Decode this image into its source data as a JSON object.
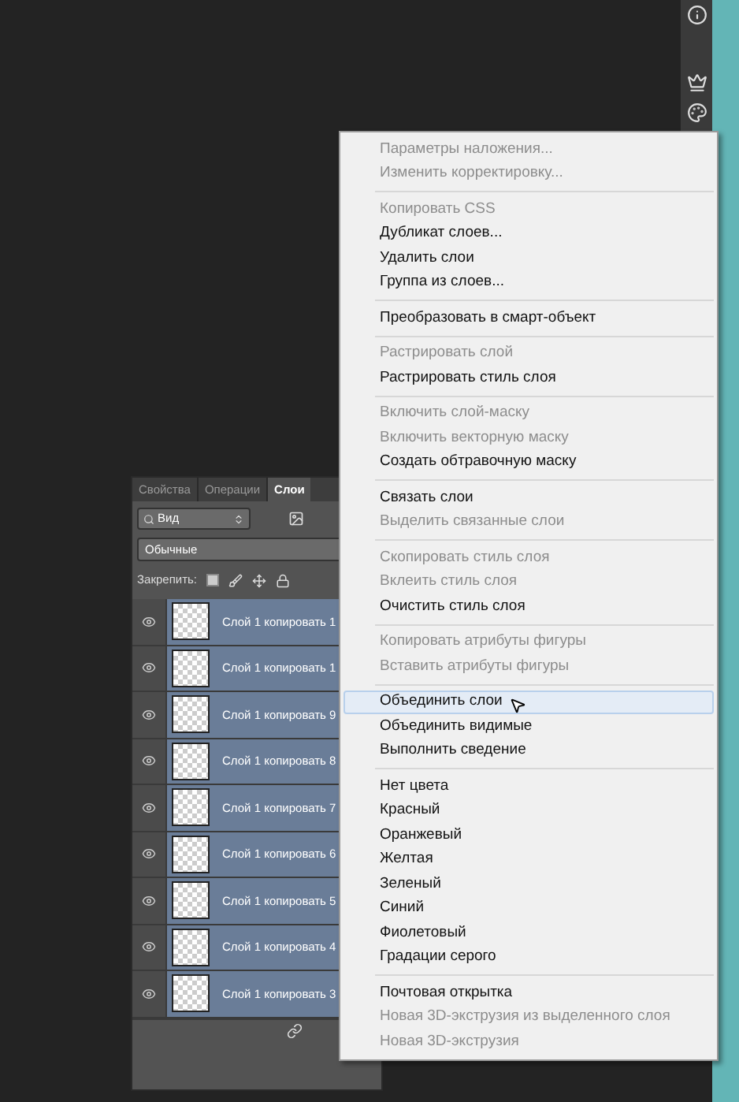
{
  "layers_panel": {
    "tabs": [
      {
        "label": "Свойства",
        "selected": false
      },
      {
        "label": "Операции",
        "selected": false
      },
      {
        "label": "Слои",
        "selected": true
      }
    ],
    "filter": {
      "value": "Вид"
    },
    "blend_mode": {
      "value": "Обычные"
    },
    "lock_label": "Закрепить:",
    "layers": [
      {
        "name": "Слой 1 копировать 1",
        "visible": true,
        "selected": true
      },
      {
        "name": "Слой 1 копировать 1",
        "visible": true,
        "selected": true
      },
      {
        "name": "Слой 1 копировать 9",
        "visible": true,
        "selected": true
      },
      {
        "name": "Слой 1 копировать 8",
        "visible": true,
        "selected": true
      },
      {
        "name": "Слой 1 копировать 7",
        "visible": true,
        "selected": true
      },
      {
        "name": "Слой 1 копировать 6",
        "visible": true,
        "selected": true
      },
      {
        "name": "Слой 1 копировать 5",
        "visible": true,
        "selected": true
      },
      {
        "name": "Слой 1 копировать 4",
        "visible": true,
        "selected": true
      },
      {
        "name": "Слой 1 копировать 3",
        "visible": true,
        "selected": true
      }
    ]
  },
  "context_menu": {
    "groups": [
      [
        {
          "label": "Параметры наложения...",
          "disabled": true,
          "hovered": false
        },
        {
          "label": "Изменить корректировку...",
          "disabled": true,
          "hovered": false
        }
      ],
      [
        {
          "label": "Копировать CSS",
          "disabled": true,
          "hovered": false
        },
        {
          "label": "Дубликат слоев...",
          "disabled": false,
          "hovered": false
        },
        {
          "label": "Удалить слои",
          "disabled": false,
          "hovered": false
        },
        {
          "label": "Группа из слоев...",
          "disabled": false,
          "hovered": false
        }
      ],
      [
        {
          "label": "Преобразовать в смарт-объект",
          "disabled": false,
          "hovered": false
        }
      ],
      [
        {
          "label": "Растрировать слой",
          "disabled": true,
          "hovered": false
        },
        {
          "label": "Растрировать стиль слоя",
          "disabled": false,
          "hovered": false
        }
      ],
      [
        {
          "label": "Включить слой-маску",
          "disabled": true,
          "hovered": false
        },
        {
          "label": "Включить векторную маску",
          "disabled": true,
          "hovered": false
        },
        {
          "label": "Создать обтравочную маску",
          "disabled": false,
          "hovered": false
        }
      ],
      [
        {
          "label": "Связать слои",
          "disabled": false,
          "hovered": false
        },
        {
          "label": "Выделить связанные слои",
          "disabled": true,
          "hovered": false
        }
      ],
      [
        {
          "label": "Скопировать стиль слоя",
          "disabled": true,
          "hovered": false
        },
        {
          "label": "Вклеить стиль слоя",
          "disabled": true,
          "hovered": false
        },
        {
          "label": "Очистить стиль слоя",
          "disabled": false,
          "hovered": false
        }
      ],
      [
        {
          "label": "Копировать атрибуты фигуры",
          "disabled": true,
          "hovered": false
        },
        {
          "label": "Вставить атрибуты фигуры",
          "disabled": true,
          "hovered": false
        }
      ],
      [
        {
          "label": "Объединить слои",
          "disabled": false,
          "hovered": true
        },
        {
          "label": "Объединить видимые",
          "disabled": false,
          "hovered": false
        },
        {
          "label": "Выполнить сведение",
          "disabled": false,
          "hovered": false
        }
      ],
      [
        {
          "label": "Нет цвета",
          "disabled": false,
          "hovered": false
        },
        {
          "label": "Красный",
          "disabled": false,
          "hovered": false
        },
        {
          "label": "Оранжевый",
          "disabled": false,
          "hovered": false
        },
        {
          "label": "Желтая",
          "disabled": false,
          "hovered": false
        },
        {
          "label": "Зеленый",
          "disabled": false,
          "hovered": false
        },
        {
          "label": "Синий",
          "disabled": false,
          "hovered": false
        },
        {
          "label": "Фиолетовый",
          "disabled": false,
          "hovered": false
        },
        {
          "label": "Градации серого",
          "disabled": false,
          "hovered": false
        }
      ],
      [
        {
          "label": "Почтовая открытка",
          "disabled": false,
          "hovered": false
        },
        {
          "label": "Новая 3D-экструзия из выделенного слоя",
          "disabled": true,
          "hovered": false
        },
        {
          "label": "Новая 3D-экструзия",
          "disabled": true,
          "hovered": false
        }
      ]
    ]
  }
}
